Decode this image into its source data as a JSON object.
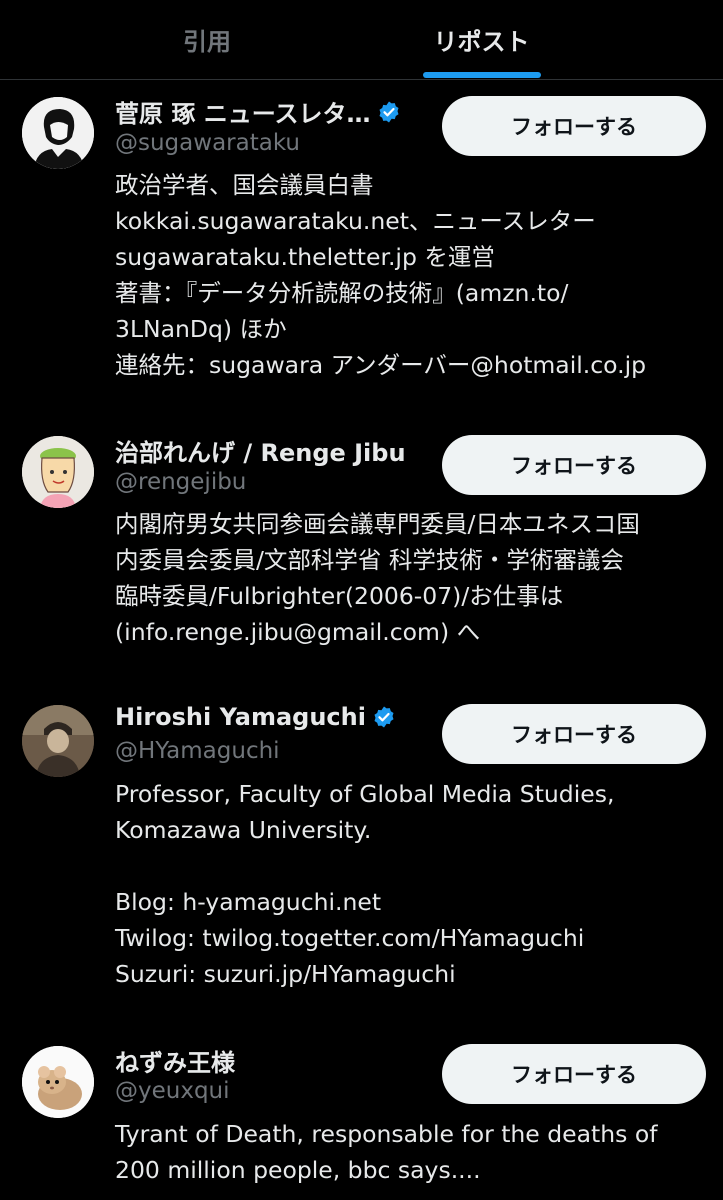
{
  "tabs": [
    {
      "label": "引用",
      "active": false
    },
    {
      "label": "リポスト",
      "active": true
    }
  ],
  "accent_color": "#1d9bf0",
  "users": [
    {
      "name": "菅原 琢 ニュースレタ…",
      "verified": true,
      "handle": "@sugawarataku",
      "follow_label": "フォローする",
      "bio": [
        "政治学者、国会議員白書",
        " kokkai.sugawarataku.net、ニュースレター",
        "sugawarataku.theletter.jp を運営",
        "著書：『データ分析読解の技術』(amzn.to/",
        "3LNanDq) ほか",
        "連絡先：sugawara アンダーバー@hotmail.co.jp"
      ]
    },
    {
      "name": "治部れんげ / Renge Jibu",
      "verified": false,
      "handle": "@rengejibu",
      "follow_label": "フォローする",
      "bio": [
        "内閣府男女共同参画会議専門委員/日本ユネスコ国",
        "内委員会委員/文部科学省 科学技術・学術審議会",
        "臨時委員/Fulbrighter(2006-07)/お仕事は",
        "(info.renge.jibu@gmail.com) へ"
      ]
    },
    {
      "name": "Hiroshi Yamaguchi",
      "verified": true,
      "handle": "@HYamaguchi",
      "follow_label": "フォローする",
      "bio": [
        "Professor, Faculty of Global Media Studies,",
        "Komazawa University.",
        "",
        "Blog: h-yamaguchi.net",
        "Twilog: twilog.togetter.com/HYamaguchi",
        "Suzuri: suzuri.jp/HYamaguchi"
      ]
    },
    {
      "name": "ねずみ王様",
      "verified": false,
      "handle": "@yeuxqui",
      "follow_label": "フォローする",
      "bio": [
        "Tyrant of Death, responsable for the deaths of",
        "200 million people, bbc says...."
      ]
    }
  ]
}
